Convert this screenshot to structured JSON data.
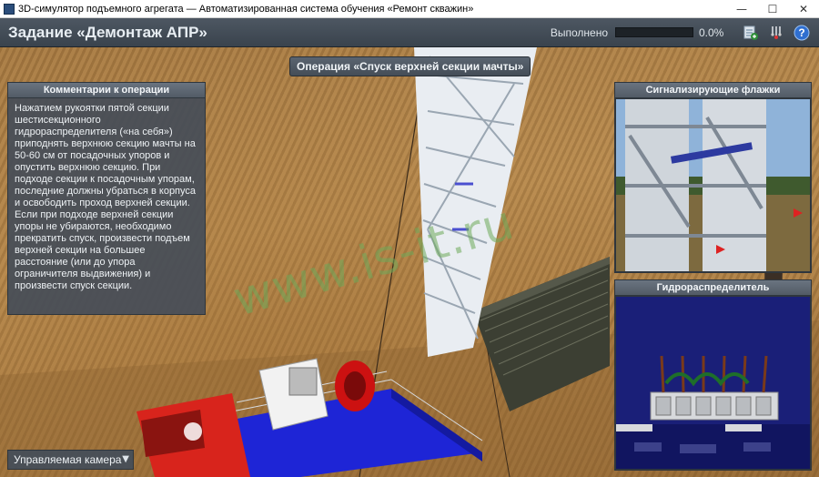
{
  "window": {
    "title": "3D-симулятор подъемного агрегата — Автоматизированная система обучения «Ремонт скважин»",
    "minimize_glyph": "—",
    "maximize_glyph": "☐",
    "close_glyph": "✕"
  },
  "header": {
    "task_title": "Задание «Демонтаж АПР»",
    "progress_label": "Выполнено",
    "progress_value": "0.0%",
    "progress_fraction": 0.0,
    "icons": [
      "report-icon",
      "tools-icon",
      "help-icon"
    ]
  },
  "operation": {
    "banner": "Операция «Спуск верхней секции мачты»"
  },
  "comments_panel": {
    "title": "Комментарии к операции",
    "text": "Нажатием рукоятки пятой секции шестисекционного гидрораспределителя («на себя») приподнять верхнюю секцию мачты на 50-60 см от посадочных упоров и опустить верхнюю секцию. При подходе секции к посадочным упорам, последние должны убраться в корпуса и освободить проход верхней секции. Если при подходе верхней секции упоры не убираются, необходимо прекратить спуск, произвести подъем верхней секции на большее расстояние (или до упора ограничителя выдвижения) и произвести спуск секции."
  },
  "flags_panel": {
    "title": "Сигнализирующие флажки"
  },
  "hydro_panel": {
    "title": "Гидрораспределитель"
  },
  "camera": {
    "selected": "Управляемая камера",
    "arrow": "▼"
  },
  "watermark": "www.is-it.ru",
  "colors": {
    "header_bg": "#434c56",
    "panel_bg": "#46505a",
    "progress_accent": "#5fa4e0",
    "truck_red": "#d8241c",
    "platform_blue": "#1e25d6"
  }
}
